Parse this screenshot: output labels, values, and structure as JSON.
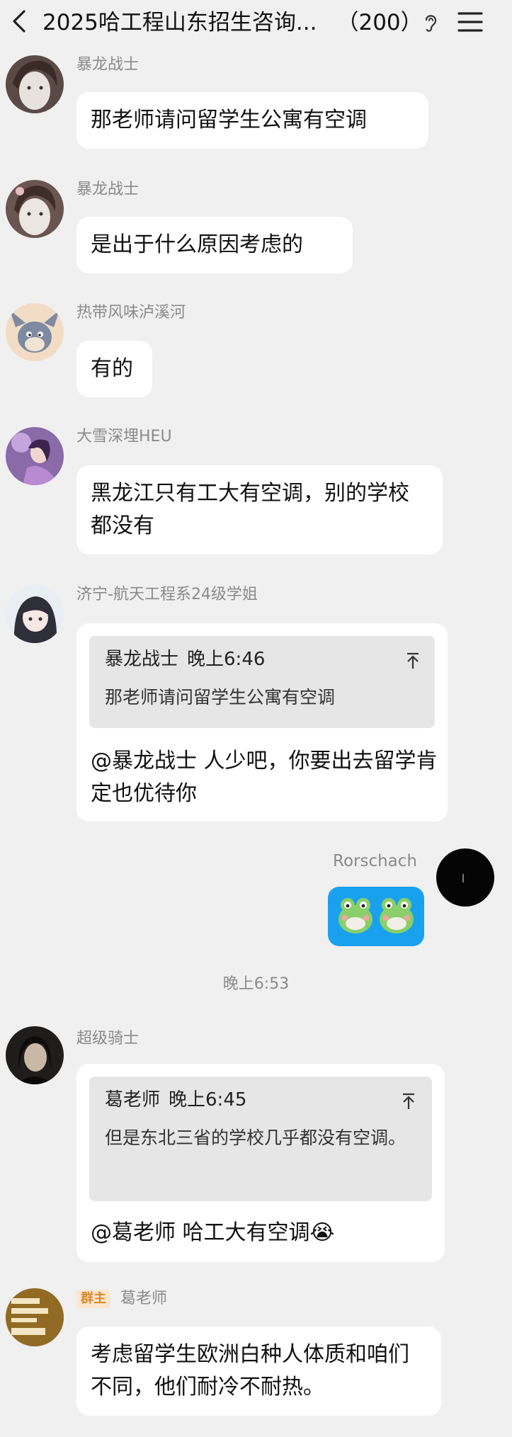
{
  "header": {
    "title": "2025哈工程山东招生咨询...",
    "member_count": "（200）",
    "colors": {
      "background": "#f0f0f0"
    }
  },
  "messages": [
    {
      "sender": "暴龙战士",
      "text": "那老师请问留学生公寓有空调"
    },
    {
      "sender": "暴龙战士",
      "text": "是出于什么原因考虑的"
    },
    {
      "sender": "热带风味泸溪河",
      "text": "有的"
    },
    {
      "sender": "大雪深埋HEU",
      "text": "黑龙江只有工大有空调，别的学校都没有"
    },
    {
      "sender": "济宁-航天工程系24级学姐",
      "quote": {
        "author": "暴龙战士",
        "time": "晚上6:46",
        "text": "那老师请问留学生公寓有空调"
      },
      "text": "@暴龙战士 人少吧，你要出去留学肯定也优待你"
    },
    {
      "sender": "Rorschach",
      "sticker": "frog-emoji-pair",
      "self": true
    },
    {
      "time_label": "晚上6:53"
    },
    {
      "sender": "超级骑士",
      "quote": {
        "author": "葛老师",
        "time": "晚上6:45",
        "text": "但是东北三省的学校几乎都没有空调。"
      },
      "text": "@葛老师 哈工大有空调😭"
    },
    {
      "sender": "葛老师",
      "badge": "群主",
      "text": "考虑留学生欧洲白种人体质和咱们不同，他们耐冷不耐热。"
    }
  ],
  "colors": {
    "page_background": "#f0f0f0",
    "bubble_background": "#ffffff",
    "self_bubble_background": "#1aa1ee",
    "quote_background": "#e6e6e6",
    "meta_text": "#8a8a8a",
    "badge_text": "#d9882b",
    "badge_background": "#fbe7cf"
  }
}
